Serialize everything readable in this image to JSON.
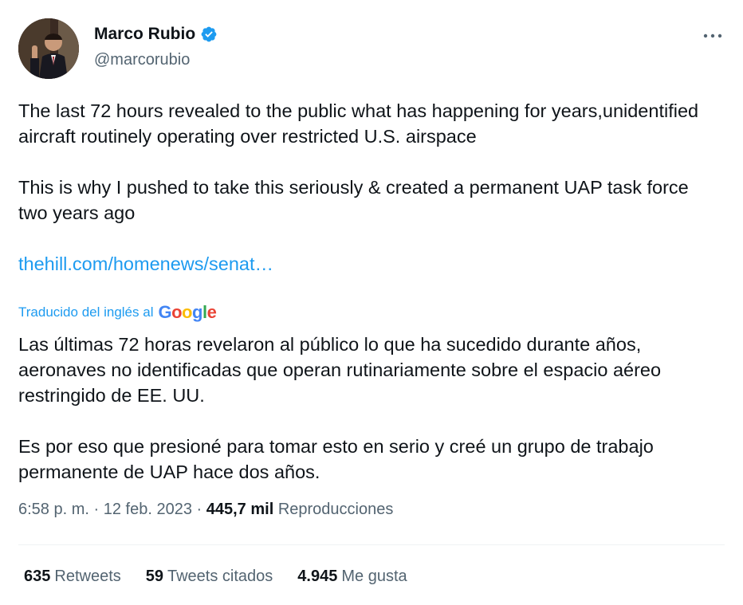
{
  "author": {
    "display_name": "Marco Rubio",
    "handle": "@marcorubio",
    "verified": true,
    "avatar_alt": "avatar"
  },
  "tweet": {
    "paragraphs": [
      "The last 72 hours revealed to the public what has happening for years,unidentified aircraft routinely operating over restricted U.S. airspace",
      "This is why I pushed to take this seriously & created a permanent UAP task force two years ago"
    ],
    "link_text": "thehill.com/homenews/senat…"
  },
  "translation": {
    "label": "Traducido del inglés al",
    "provider": "Google",
    "paragraphs": [
      "Las últimas 72 horas revelaron al público lo que ha sucedido durante años, aeronaves no identificadas que operan rutinariamente sobre el espacio aéreo restringido de EE. UU.",
      "Es por eso que presioné para tomar esto en serio y creé un grupo de trabajo permanente de UAP hace dos años."
    ]
  },
  "meta": {
    "time": "6:58 p. m.",
    "separator": "·",
    "date": "12 feb. 2023",
    "views_count": "445,7 mil",
    "views_label": "Reproducciones"
  },
  "stats": [
    {
      "count": "635",
      "label": "Retweets"
    },
    {
      "count": "59",
      "label": "Tweets citados"
    },
    {
      "count": "4.945",
      "label": "Me gusta"
    }
  ],
  "colors": {
    "accent": "#1d9bf0",
    "text": "#0f1419",
    "secondary": "#536471",
    "divider": "#eff3f4"
  },
  "icons": {
    "verified": "verified-badge-icon",
    "more": "more-options-icon"
  }
}
